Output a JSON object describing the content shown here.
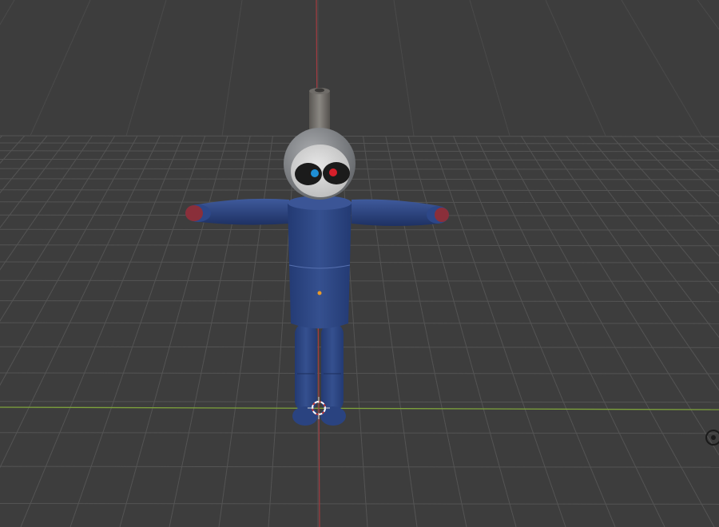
{
  "viewport": {
    "background": "#3d3d3d",
    "grid_color": "#545454",
    "x_axis_color": "#7ea33c",
    "y_axis_color": "#a33b40"
  },
  "character": {
    "body_color": "#2f4a8a",
    "hand_color": "#8a2f3a",
    "head_color": "#8a8d92",
    "face_color": "#d8d8d8",
    "eye_left_color": "#1f8fd6",
    "eye_right_color": "#d61f2a",
    "antenna_color": "#6d6a66"
  },
  "origin_marker_color": "#e89a2a",
  "cursor_3d_icon": "3d-cursor-icon",
  "nav_gizmo_icon": "rotate-view-icon"
}
